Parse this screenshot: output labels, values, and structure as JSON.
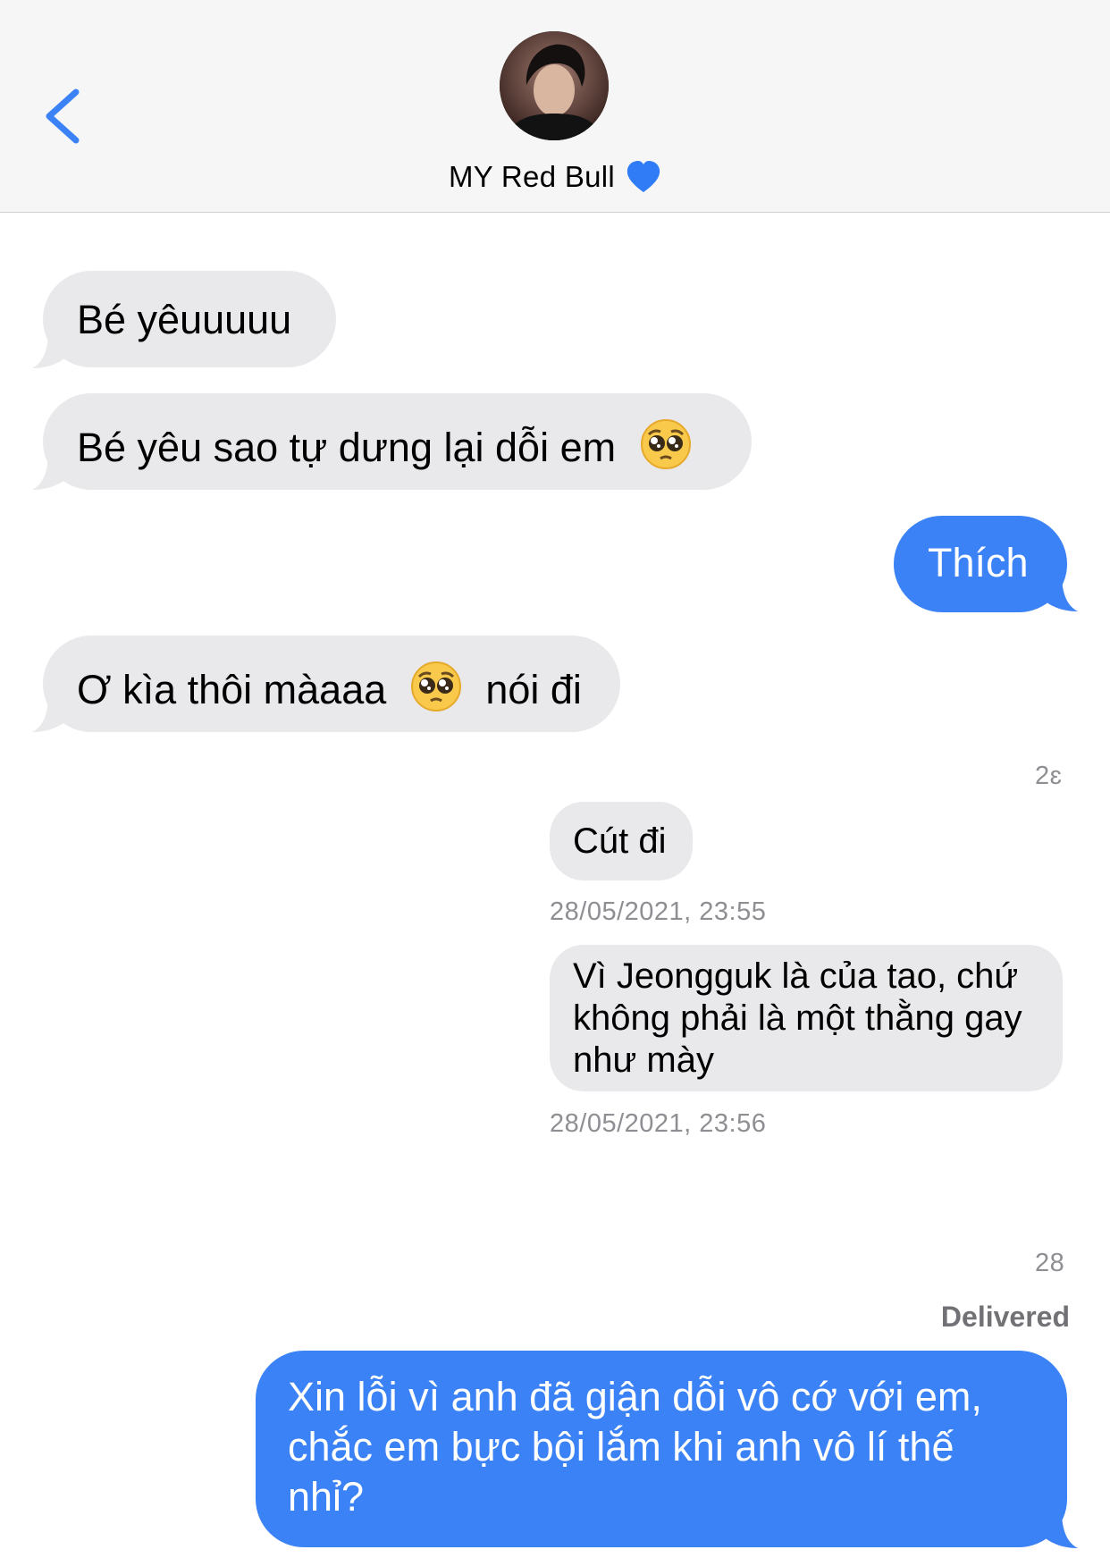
{
  "header": {
    "back_icon": "chevron-left-icon",
    "contact_name": "MY Red Bull",
    "heart_icon": "blue-heart-emoji",
    "accent": "#3b82f6"
  },
  "messages": [
    {
      "side": "incoming",
      "text": "Bé yêuuuuu"
    },
    {
      "side": "incoming",
      "text": "Bé yêu sao tự dưng lại dỗi em",
      "emoji": "pleading-face-emoji"
    },
    {
      "side": "outgoing",
      "text": "Thích"
    },
    {
      "side": "incoming",
      "text_before": "Ơ kìa thôi màaaa",
      "emoji": "pleading-face-emoji",
      "text_after": "nói đi"
    },
    {
      "side": "quoted",
      "text": "Cút đi",
      "timestamp": "28/05/2021, 23:55"
    },
    {
      "side": "quoted",
      "lines": [
        "Vì Jeongguk là của tao, chứ",
        "không phải là một thằng gay",
        "như mày"
      ],
      "timestamp": "28/05/2021, 23:56"
    },
    {
      "side": "outgoing",
      "lines": [
        "Xin lỗi vì anh đã giận dỗi vô cớ với em,",
        "chắc em bực bội lắm khi anh vô lí thế",
        "nhỉ?"
      ]
    }
  ],
  "side_labels": {
    "top": "2ɛ",
    "bottom": "28"
  },
  "status": {
    "delivered": "Delivered"
  },
  "colors": {
    "incoming_bubble": "#e9e9eb",
    "outgoing_bubble": "#3b82f6",
    "header_bg": "#f6f6f6"
  }
}
